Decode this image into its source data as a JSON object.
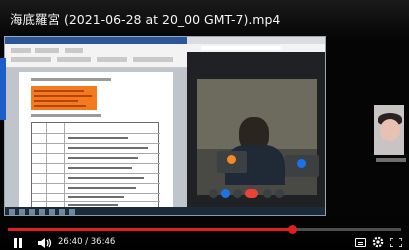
{
  "video": {
    "title": "海底羅宮 (2021-06-28 at 20_00 GMT-7).mp4",
    "time_display": "26:40 / 36:46",
    "progress_fraction": 0.725
  },
  "icons": {
    "play_pause": "pause-icon",
    "volume": "volume-icon",
    "captions": "captions-icon",
    "settings": "gear-icon",
    "fullscreen": "fullscreen-icon"
  },
  "colors": {
    "progress": "#e02020",
    "doc_highlight": "#f47a1f",
    "meet_end_call": "#ea4335",
    "meet_blue": "#1a73e8"
  }
}
